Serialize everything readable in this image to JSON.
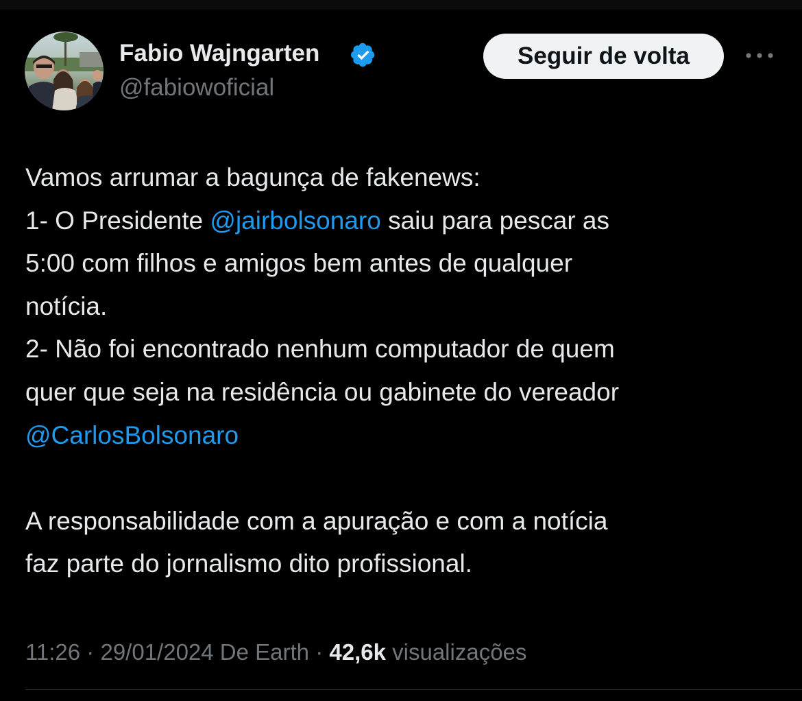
{
  "user": {
    "display_name": "Fabio Wajngarten",
    "handle": "@fabiowoficial",
    "verified_icon": "verified-badge-icon"
  },
  "header": {
    "follow_button_label": "Seguir de volta",
    "more_icon": "more-dots-icon"
  },
  "tweet": {
    "line1": "Vamos arrumar a bagunça de fakenews:",
    "line2_pre": "1- O Presidente ",
    "line2_mention": "@jairbolsonaro",
    "line2_post": " saiu para pescar as",
    "line3": "5:00 com filhos e amigos bem antes de qualquer",
    "line4": "notícia.",
    "line5": "2- Não foi encontrado nenhum computador de quem",
    "line6": "quer que seja na residência ou gabinete do vereador",
    "line7_mention": "@CarlosBolsonaro",
    "line8": "A responsabilidade com a apuração e com a notícia",
    "line9": "faz parte do jornalismo dito profissional."
  },
  "meta": {
    "time": "11:26",
    "sep1": " · ",
    "date": "29/01/2024",
    "source": " De Earth",
    "sep2": " · ",
    "views_count": "42,6k",
    "views_label": " visualizações"
  },
  "colors": {
    "background": "#000000",
    "text": "#e7e9ea",
    "secondary": "#71767b",
    "link": "#1d9bf0",
    "button_bg": "#eff3f4"
  }
}
